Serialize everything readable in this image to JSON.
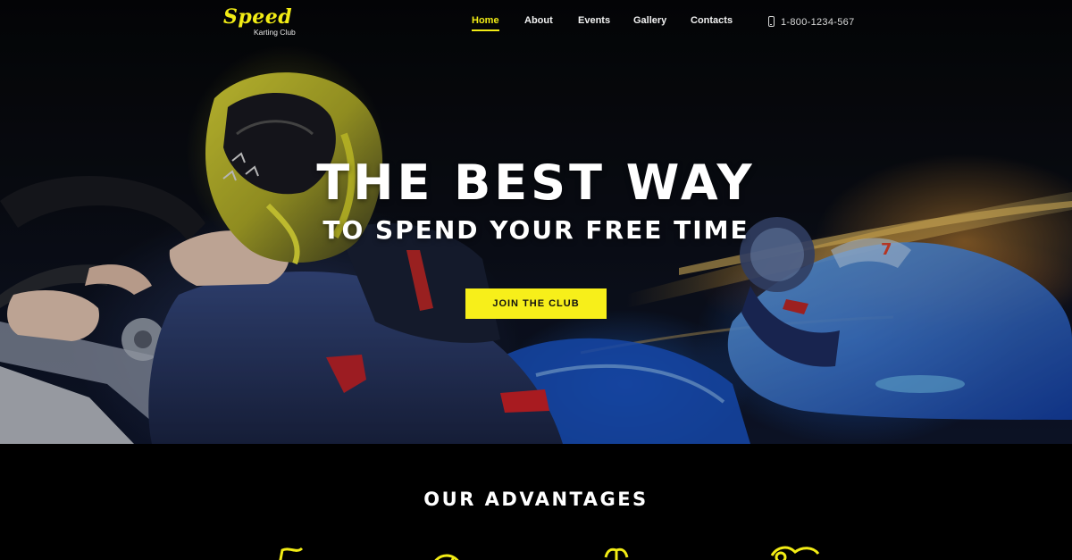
{
  "header": {
    "logo": {
      "title": "Speed",
      "subtitle": "Karting Club"
    },
    "nav": [
      {
        "label": "Home",
        "active": true
      },
      {
        "label": "About",
        "active": false
      },
      {
        "label": "Events",
        "active": false
      },
      {
        "label": "Gallery",
        "active": false
      },
      {
        "label": "Contacts",
        "active": false
      }
    ],
    "phone": {
      "icon": "phone-icon",
      "number": "1-800-1234-567"
    }
  },
  "hero": {
    "headline": "THE BEST WAY",
    "subheadline": "TO SPEND YOUR FREE TIME",
    "cta_label": "JOIN THE CLUB"
  },
  "advantages": {
    "title": "OUR ADVANTAGES",
    "icons": [
      "flag-icon",
      "speedometer-icon",
      "trophy-icon",
      "kart-icon"
    ]
  },
  "colors": {
    "accent": "#f2ec15",
    "background": "#000000",
    "text": "#ffffff"
  }
}
